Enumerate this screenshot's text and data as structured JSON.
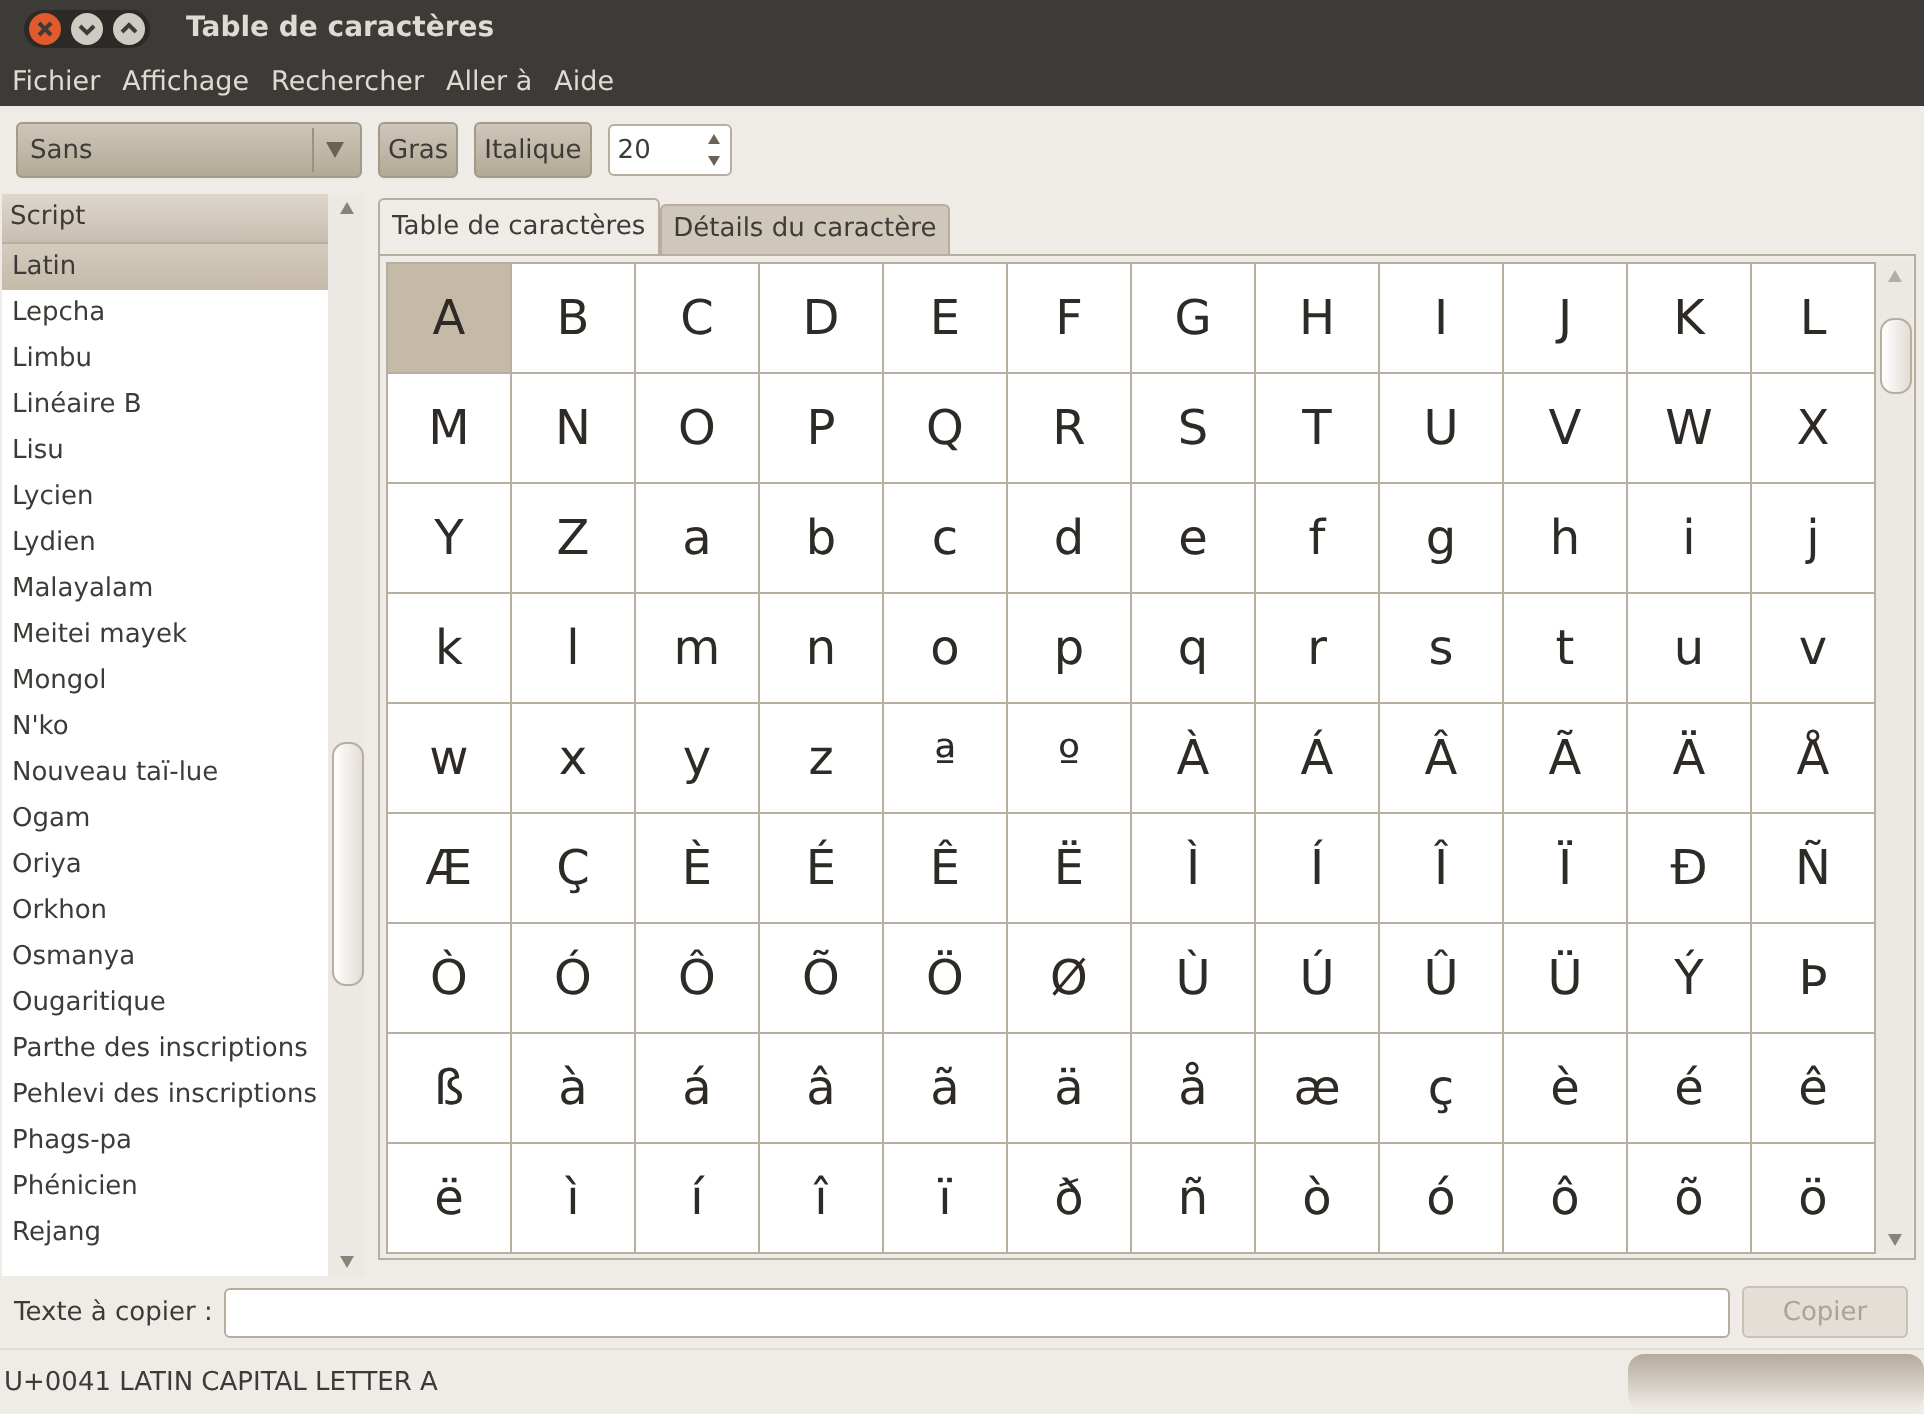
{
  "window": {
    "title": "Table de caractères"
  },
  "menu": [
    "Fichier",
    "Affichage",
    "Rechercher",
    "Aller à",
    "Aide"
  ],
  "toolbar": {
    "font": "Sans",
    "bold_label": "Gras",
    "italic_label": "Italique",
    "size": "20"
  },
  "sidebar": {
    "header": "Script",
    "items": [
      {
        "label": "Latin",
        "selected": true
      },
      {
        "label": "Lepcha",
        "selected": false
      },
      {
        "label": "Limbu",
        "selected": false
      },
      {
        "label": "Linéaire B",
        "selected": false
      },
      {
        "label": "Lisu",
        "selected": false
      },
      {
        "label": "Lycien",
        "selected": false
      },
      {
        "label": "Lydien",
        "selected": false
      },
      {
        "label": "Malayalam",
        "selected": false
      },
      {
        "label": "Meitei mayek",
        "selected": false
      },
      {
        "label": "Mongol",
        "selected": false
      },
      {
        "label": "N'ko",
        "selected": false
      },
      {
        "label": "Nouveau taï-lue",
        "selected": false
      },
      {
        "label": "Ogam",
        "selected": false
      },
      {
        "label": "Oriya",
        "selected": false
      },
      {
        "label": "Orkhon",
        "selected": false
      },
      {
        "label": "Osmanya",
        "selected": false
      },
      {
        "label": "Ougaritique",
        "selected": false
      },
      {
        "label": "Parthe des inscriptions",
        "selected": false
      },
      {
        "label": "Pehlevi des inscriptions",
        "selected": false
      },
      {
        "label": "Phags-pa",
        "selected": false
      },
      {
        "label": "Phénicien",
        "selected": false
      },
      {
        "label": "Rejang",
        "selected": false
      }
    ]
  },
  "tabs": [
    {
      "label": "Table de caractères",
      "selected": true
    },
    {
      "label": "Détails du caractère",
      "selected": false
    }
  ],
  "grid": [
    [
      {
        "char": "A",
        "selected": true
      },
      {
        "char": "B",
        "selected": false
      },
      {
        "char": "C",
        "selected": false
      },
      {
        "char": "D",
        "selected": false
      },
      {
        "char": "E",
        "selected": false
      },
      {
        "char": "F",
        "selected": false
      },
      {
        "char": "G",
        "selected": false
      },
      {
        "char": "H",
        "selected": false
      },
      {
        "char": "I",
        "selected": false
      },
      {
        "char": "J",
        "selected": false
      },
      {
        "char": "K",
        "selected": false
      },
      {
        "char": "L",
        "selected": false
      }
    ],
    [
      {
        "char": "M",
        "selected": false
      },
      {
        "char": "N",
        "selected": false
      },
      {
        "char": "O",
        "selected": false
      },
      {
        "char": "P",
        "selected": false
      },
      {
        "char": "Q",
        "selected": false
      },
      {
        "char": "R",
        "selected": false
      },
      {
        "char": "S",
        "selected": false
      },
      {
        "char": "T",
        "selected": false
      },
      {
        "char": "U",
        "selected": false
      },
      {
        "char": "V",
        "selected": false
      },
      {
        "char": "W",
        "selected": false
      },
      {
        "char": "X",
        "selected": false
      }
    ],
    [
      {
        "char": "Y",
        "selected": false
      },
      {
        "char": "Z",
        "selected": false
      },
      {
        "char": "a",
        "selected": false
      },
      {
        "char": "b",
        "selected": false
      },
      {
        "char": "c",
        "selected": false
      },
      {
        "char": "d",
        "selected": false
      },
      {
        "char": "e",
        "selected": false
      },
      {
        "char": "f",
        "selected": false
      },
      {
        "char": "g",
        "selected": false
      },
      {
        "char": "h",
        "selected": false
      },
      {
        "char": "i",
        "selected": false
      },
      {
        "char": "j",
        "selected": false
      }
    ],
    [
      {
        "char": "k",
        "selected": false
      },
      {
        "char": "l",
        "selected": false
      },
      {
        "char": "m",
        "selected": false
      },
      {
        "char": "n",
        "selected": false
      },
      {
        "char": "o",
        "selected": false
      },
      {
        "char": "p",
        "selected": false
      },
      {
        "char": "q",
        "selected": false
      },
      {
        "char": "r",
        "selected": false
      },
      {
        "char": "s",
        "selected": false
      },
      {
        "char": "t",
        "selected": false
      },
      {
        "char": "u",
        "selected": false
      },
      {
        "char": "v",
        "selected": false
      }
    ],
    [
      {
        "char": "w",
        "selected": false
      },
      {
        "char": "x",
        "selected": false
      },
      {
        "char": "y",
        "selected": false
      },
      {
        "char": "z",
        "selected": false
      },
      {
        "char": "ª",
        "selected": false
      },
      {
        "char": "º",
        "selected": false
      },
      {
        "char": "À",
        "selected": false
      },
      {
        "char": "Á",
        "selected": false
      },
      {
        "char": "Â",
        "selected": false
      },
      {
        "char": "Ã",
        "selected": false
      },
      {
        "char": "Ä",
        "selected": false
      },
      {
        "char": "Å",
        "selected": false
      }
    ],
    [
      {
        "char": "Æ",
        "selected": false
      },
      {
        "char": "Ç",
        "selected": false
      },
      {
        "char": "È",
        "selected": false
      },
      {
        "char": "É",
        "selected": false
      },
      {
        "char": "Ê",
        "selected": false
      },
      {
        "char": "Ë",
        "selected": false
      },
      {
        "char": "Ì",
        "selected": false
      },
      {
        "char": "Í",
        "selected": false
      },
      {
        "char": "Î",
        "selected": false
      },
      {
        "char": "Ï",
        "selected": false
      },
      {
        "char": "Đ",
        "selected": false
      },
      {
        "char": "Ñ",
        "selected": false
      }
    ],
    [
      {
        "char": "Ò",
        "selected": false
      },
      {
        "char": "Ó",
        "selected": false
      },
      {
        "char": "Ô",
        "selected": false
      },
      {
        "char": "Õ",
        "selected": false
      },
      {
        "char": "Ö",
        "selected": false
      },
      {
        "char": "Ø",
        "selected": false
      },
      {
        "char": "Ù",
        "selected": false
      },
      {
        "char": "Ú",
        "selected": false
      },
      {
        "char": "Û",
        "selected": false
      },
      {
        "char": "Ü",
        "selected": false
      },
      {
        "char": "Ý",
        "selected": false
      },
      {
        "char": "Þ",
        "selected": false
      }
    ],
    [
      {
        "char": "ß",
        "selected": false
      },
      {
        "char": "à",
        "selected": false
      },
      {
        "char": "á",
        "selected": false
      },
      {
        "char": "â",
        "selected": false
      },
      {
        "char": "ã",
        "selected": false
      },
      {
        "char": "ä",
        "selected": false
      },
      {
        "char": "å",
        "selected": false
      },
      {
        "char": "æ",
        "selected": false
      },
      {
        "char": "ç",
        "selected": false
      },
      {
        "char": "è",
        "selected": false
      },
      {
        "char": "é",
        "selected": false
      },
      {
        "char": "ê",
        "selected": false
      }
    ],
    [
      {
        "char": "ë",
        "selected": false
      },
      {
        "char": "ì",
        "selected": false
      },
      {
        "char": "í",
        "selected": false
      },
      {
        "char": "î",
        "selected": false
      },
      {
        "char": "ï",
        "selected": false
      },
      {
        "char": "ð",
        "selected": false
      },
      {
        "char": "ñ",
        "selected": false
      },
      {
        "char": "ò",
        "selected": false
      },
      {
        "char": "ó",
        "selected": false
      },
      {
        "char": "ô",
        "selected": false
      },
      {
        "char": "õ",
        "selected": false
      },
      {
        "char": "ö",
        "selected": false
      }
    ]
  ],
  "copy": {
    "label": "Texte à copier :",
    "button": "Copier",
    "disabled": true
  },
  "status_bar": "U+0041 LATIN CAPITAL LETTER A"
}
